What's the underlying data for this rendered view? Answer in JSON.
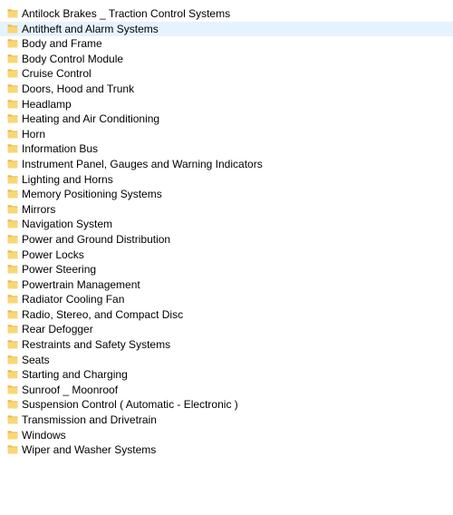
{
  "folder_list": {
    "hovered_index": 1,
    "folder_color": "#f8d775",
    "folder_shade": "#e8b949",
    "items": [
      {
        "label": "Antilock Brakes _ Traction Control Systems"
      },
      {
        "label": "Antitheft and Alarm Systems"
      },
      {
        "label": "Body and Frame"
      },
      {
        "label": "Body Control Module"
      },
      {
        "label": "Cruise Control"
      },
      {
        "label": "Doors, Hood and Trunk"
      },
      {
        "label": "Headlamp"
      },
      {
        "label": "Heating and Air Conditioning"
      },
      {
        "label": "Horn"
      },
      {
        "label": "Information Bus"
      },
      {
        "label": "Instrument Panel, Gauges and Warning Indicators"
      },
      {
        "label": "Lighting and Horns"
      },
      {
        "label": "Memory Positioning Systems"
      },
      {
        "label": "Mirrors"
      },
      {
        "label": "Navigation System"
      },
      {
        "label": "Power and Ground Distribution"
      },
      {
        "label": "Power Locks"
      },
      {
        "label": "Power Steering"
      },
      {
        "label": "Powertrain Management"
      },
      {
        "label": "Radiator Cooling Fan"
      },
      {
        "label": "Radio, Stereo, and Compact Disc"
      },
      {
        "label": "Rear Defogger"
      },
      {
        "label": "Restraints and Safety Systems"
      },
      {
        "label": "Seats"
      },
      {
        "label": "Starting and Charging"
      },
      {
        "label": "Sunroof _ Moonroof"
      },
      {
        "label": "Suspension Control ( Automatic - Electronic )"
      },
      {
        "label": "Transmission and Drivetrain"
      },
      {
        "label": "Windows"
      },
      {
        "label": "Wiper and Washer Systems"
      }
    ]
  }
}
